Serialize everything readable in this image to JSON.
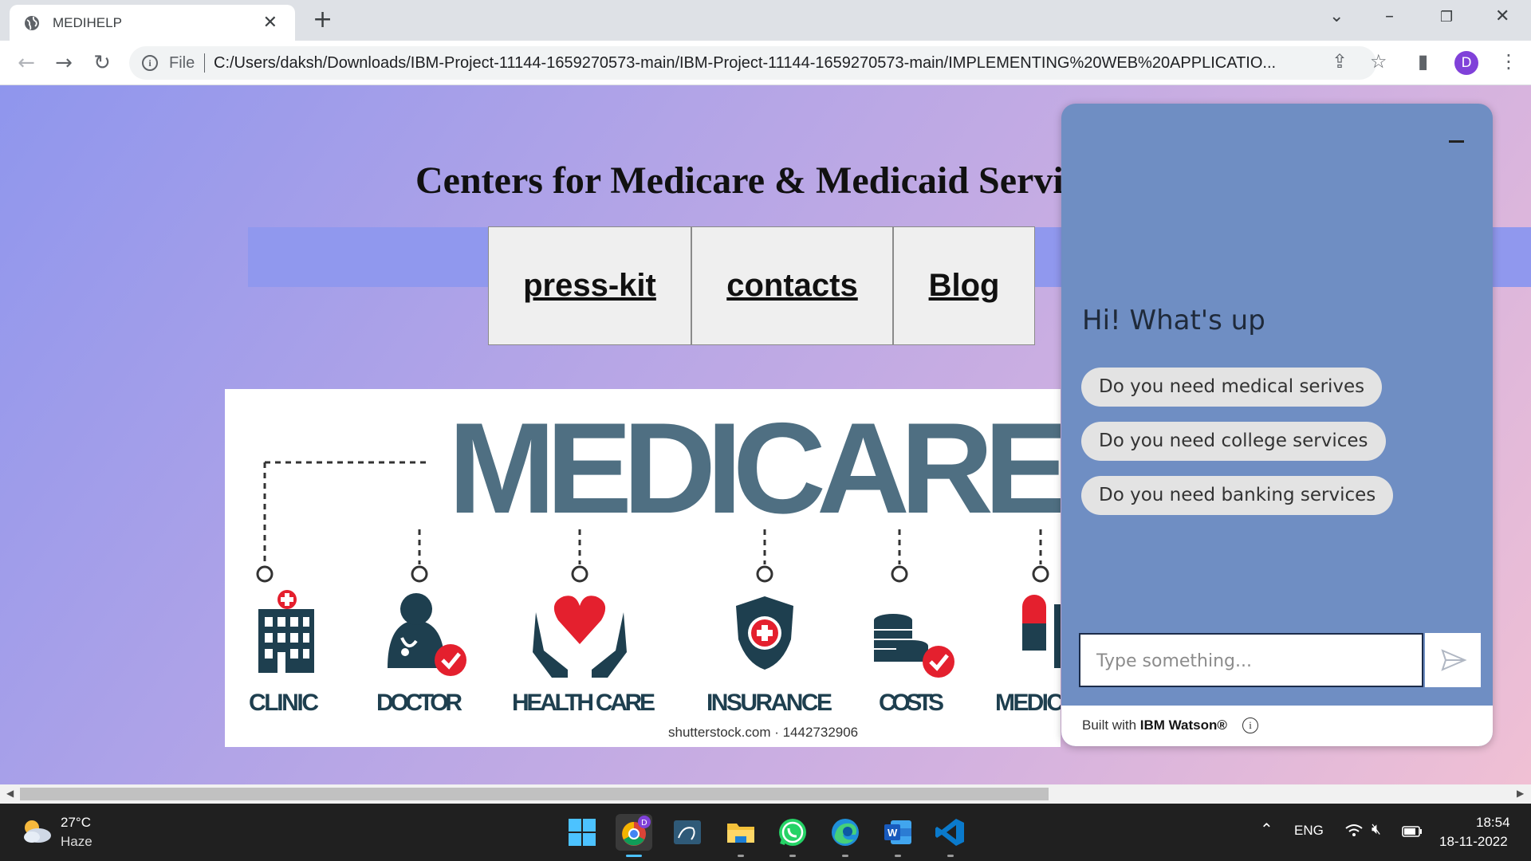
{
  "browser": {
    "tab_title": "MEDIHELP",
    "tab_close": "✕",
    "new_tab": "+",
    "address_scheme": "File",
    "address_url": "C:/Users/daksh/Downloads/IBM-Project-11144-1659270573-main/IBM-Project-11144-1659270573-main/IMPLEMENTING%20WEB%20APPLICATIO...",
    "profile_initial": "D"
  },
  "page": {
    "heading": "Centers for Medicare & Medicaid Services",
    "nav_links": [
      "press-kit",
      "contacts",
      "Blog"
    ],
    "banner": {
      "title": "MEDICARE",
      "categories": [
        "CLINIC",
        "DOCTOR",
        "HEALTH CARE",
        "INSURANCE",
        "COSTS",
        "MEDIC"
      ],
      "credit": "shutterstock.com · 1442732906"
    }
  },
  "chatbot": {
    "greeting": "Hi! What's up",
    "options": [
      "Do you need medical serives",
      "Do you need college services",
      "Do you need banking services"
    ],
    "input_placeholder": "Type something...",
    "footer_prefix": "Built with ",
    "footer_brand": "IBM Watson®",
    "minimize_icon": "minimize-icon",
    "send_icon": "send-icon"
  },
  "taskbar": {
    "temperature": "27°C",
    "condition": "Haze",
    "language": "ENG",
    "time": "18:54",
    "date": "18-11-2022",
    "chrome_badge": "D"
  },
  "colors": {
    "chat_panel": "#6f8ec3",
    "medicare_text": "#4f6f82",
    "heart": "#e4202e",
    "check": "#e4202e"
  }
}
